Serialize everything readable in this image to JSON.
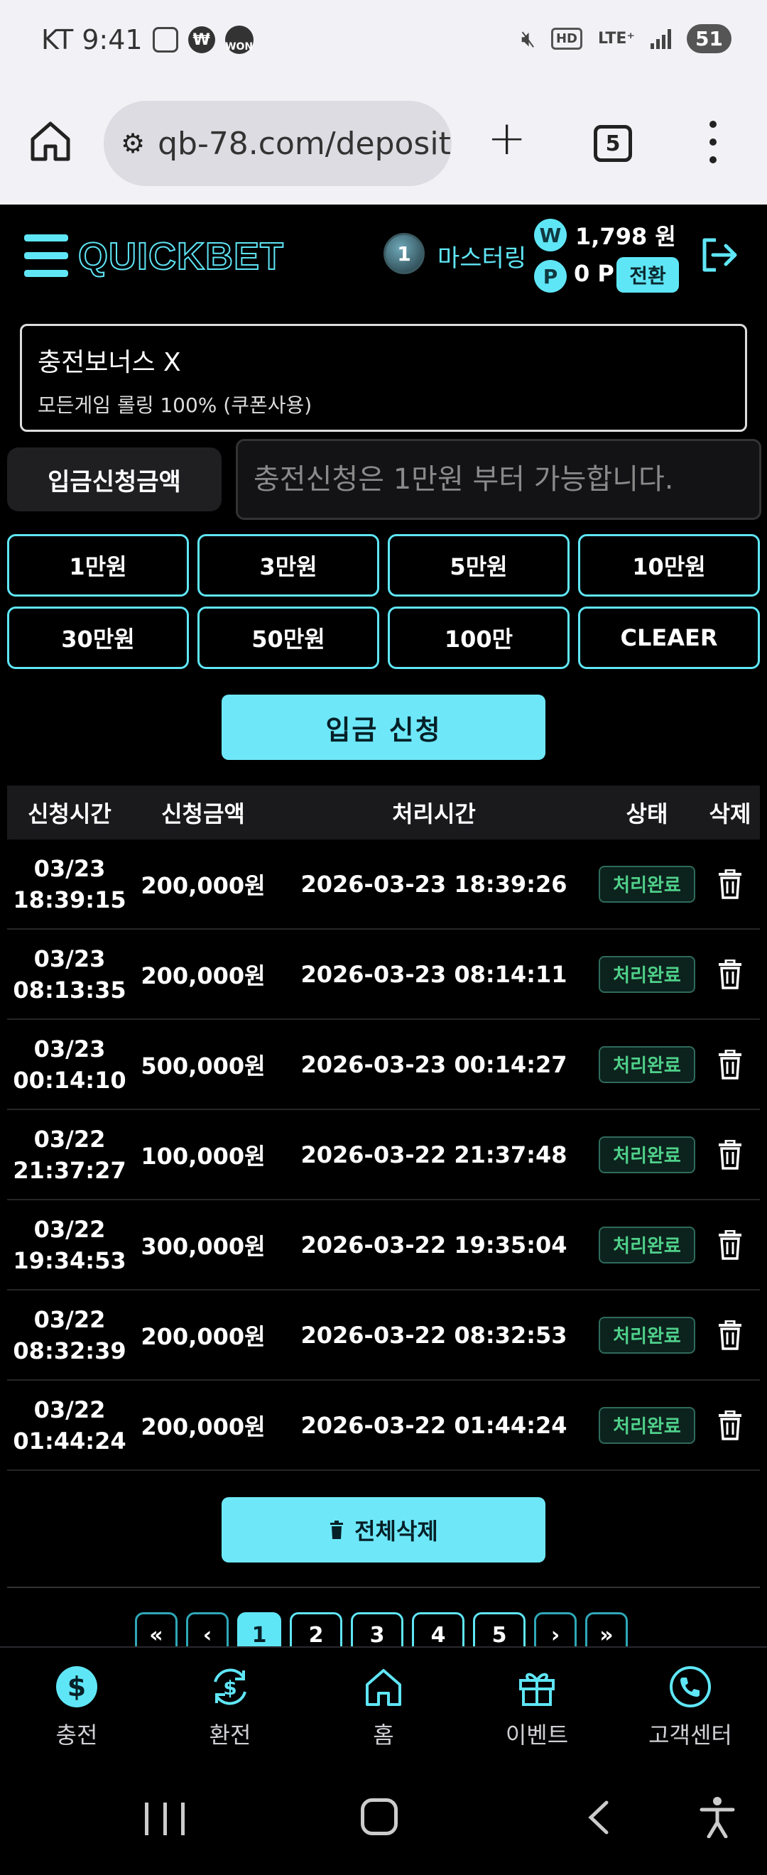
{
  "status_bar": {
    "carrier_time": "KT 9:41",
    "won_icon_text": "WON",
    "hd": "HD",
    "lte": "LTE⁺",
    "battery": "51"
  },
  "browser": {
    "url": "qb-78.com/deposit",
    "tab_count": "5"
  },
  "header": {
    "logo": "QUICKBET",
    "level_badge": "1",
    "level_name": "마스터링",
    "won_symbol": "W",
    "balance": "1,798 원",
    "point_symbol": "P",
    "points": "0 P",
    "convert_label": "전환"
  },
  "bonus": {
    "title": "충전보너스 X",
    "desc": "모든게임 롤링 100% (쿠폰사용)"
  },
  "deposit": {
    "amount_label": "입금신청금액",
    "amount_placeholder": "충전신청은 1만원 부터 가능합니다.",
    "quick_amounts": [
      "1만원",
      "3만원",
      "5만원",
      "10만원",
      "30만원",
      "50만원",
      "100만",
      "CLEAER"
    ],
    "submit_label": "입금 신청"
  },
  "table": {
    "headers": [
      "신청시간",
      "신청금액",
      "처리시간",
      "상태",
      "삭제"
    ],
    "rows": [
      {
        "date": "03/23",
        "time": "18:39:15",
        "amount": "200,000원",
        "processed": "2026-03-23 18:39:26",
        "status": "처리완료"
      },
      {
        "date": "03/23",
        "time": "08:13:35",
        "amount": "200,000원",
        "processed": "2026-03-23 08:14:11",
        "status": "처리완료"
      },
      {
        "date": "03/23",
        "time": "00:14:10",
        "amount": "500,000원",
        "processed": "2026-03-23 00:14:27",
        "status": "처리완료"
      },
      {
        "date": "03/22",
        "time": "21:37:27",
        "amount": "100,000원",
        "processed": "2026-03-22 21:37:48",
        "status": "처리완료"
      },
      {
        "date": "03/22",
        "time": "19:34:53",
        "amount": "300,000원",
        "processed": "2026-03-22 19:35:04",
        "status": "처리완료"
      },
      {
        "date": "03/22",
        "time": "08:32:39",
        "amount": "200,000원",
        "processed": "2026-03-22 08:32:53",
        "status": "처리완료"
      },
      {
        "date": "03/22",
        "time": "01:44:24",
        "amount": "200,000원",
        "processed": "2026-03-22 01:44:24",
        "status": "처리완료"
      }
    ],
    "delete_all_label": "전체삭제"
  },
  "pagination": {
    "first": "«",
    "prev": "‹",
    "pages": [
      "1",
      "2",
      "3",
      "4",
      "5"
    ],
    "next": "›",
    "last": "»",
    "current": "1"
  },
  "bottom_nav": [
    {
      "label": "충전",
      "icon": "dollar-coin-icon"
    },
    {
      "label": "환전",
      "icon": "exchange-icon"
    },
    {
      "label": "홈",
      "icon": "home-icon"
    },
    {
      "label": "이벤트",
      "icon": "gift-icon"
    },
    {
      "label": "고객센터",
      "icon": "phone-icon"
    }
  ],
  "colors": {
    "accent": "#5fe6f6",
    "status_text": "#4fd08a",
    "background": "#000000"
  }
}
